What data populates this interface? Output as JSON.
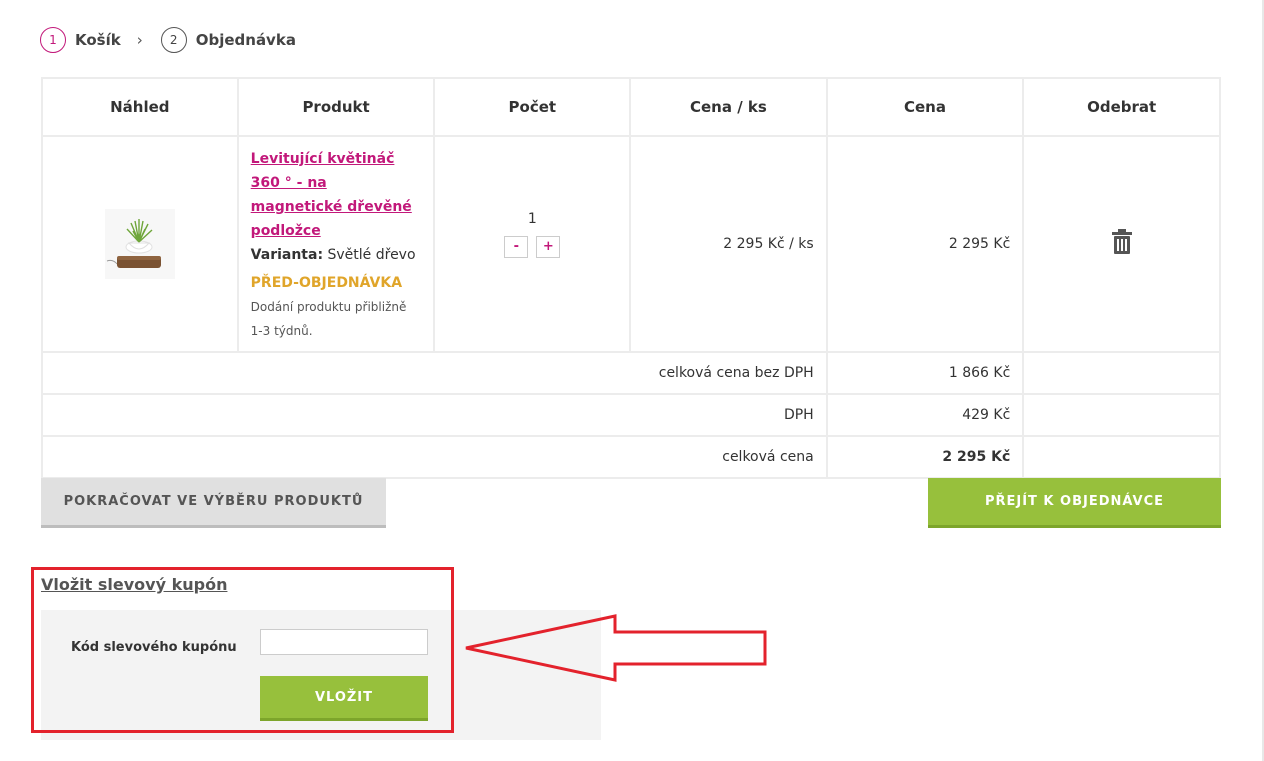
{
  "steps": [
    {
      "num": "1",
      "label": "Košík"
    },
    {
      "num": "2",
      "label": "Objednávka"
    }
  ],
  "step_separator": "›",
  "table": {
    "headers": [
      "Náhled",
      "Produkt",
      "Počet",
      "Cena / ks",
      "Cena",
      "Odebrat"
    ],
    "item": {
      "name": "Levitující květináč 360 ° - na magnetické dřevěné podložce",
      "variant_label": "Varianta:",
      "variant_value": "Světlé dřevo",
      "preorder": "PŘED-OBJEDNÁVKA",
      "delivery": "Dodání produktu přibližně 1-3 týdnů.",
      "quantity": "1",
      "minus": "-",
      "plus": "+",
      "unit_price": "2 295 Kč / ks",
      "price": "2 295 Kč",
      "remove_icon": "trash-icon"
    },
    "summary": [
      {
        "label": "celková cena bez DPH",
        "value": "1 866 Kč"
      },
      {
        "label": "DPH",
        "value": "429 Kč"
      },
      {
        "label": "celková cena",
        "value": "2 295 Kč"
      }
    ]
  },
  "buttons": {
    "continue": "POKRAČOVAT VE VÝBĚRU PRODUKTŮ",
    "order": "PŘEJÍT K OBJEDNÁVCE"
  },
  "coupon": {
    "title": "Vložit slevový kupón",
    "label": "Kód slevového kupónu",
    "value": "",
    "submit": "VLOŽIT"
  },
  "colors": {
    "accent": "#c2187a",
    "preorder": "#e0a52a",
    "green": "#97c03c",
    "annotation": "#e3222c"
  }
}
